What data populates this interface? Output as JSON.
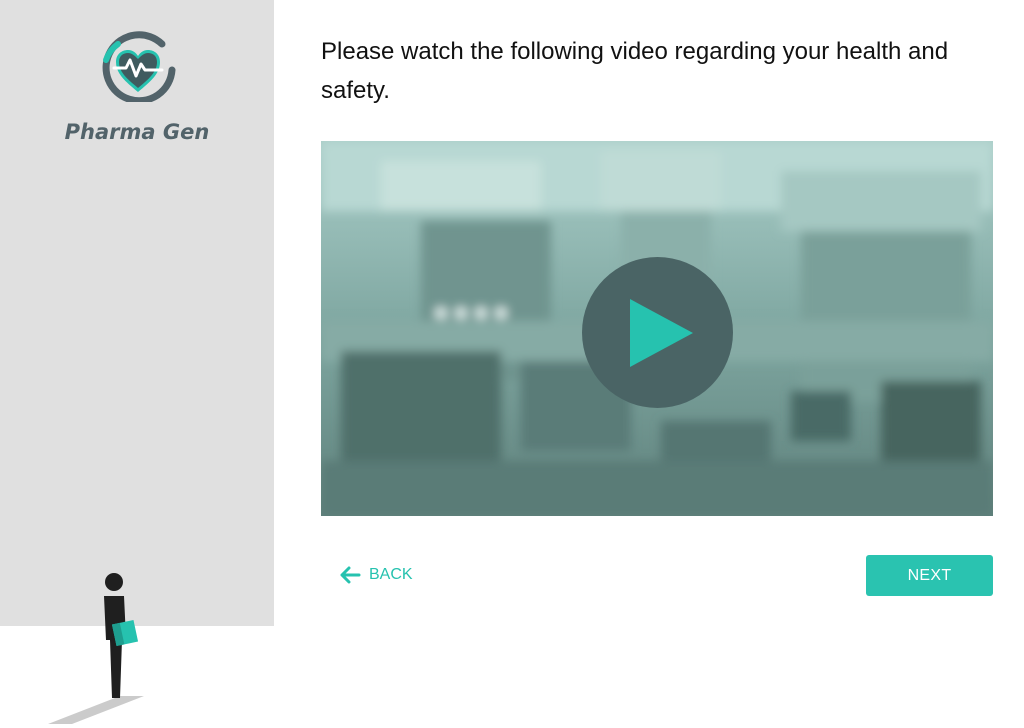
{
  "brand": {
    "name": "Pharma Gen",
    "logo_icon": "heart-pulse-icon",
    "colors": {
      "accent": "#26c2af",
      "logo_text": "#52636a",
      "play_circle": "#4a6465",
      "sidebar_bg": "#e0e0e0"
    }
  },
  "main": {
    "heading": "Please watch the following video regarding your health and safety."
  },
  "video": {
    "play_icon": "play-icon"
  },
  "nav": {
    "back_label": "BACK",
    "back_icon": "arrow-left-icon",
    "next_label": "NEXT"
  }
}
